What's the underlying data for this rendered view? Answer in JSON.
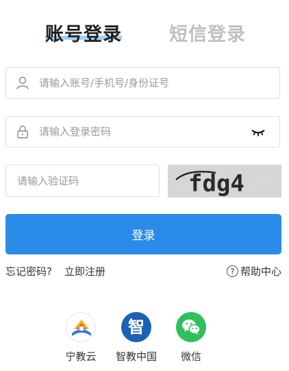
{
  "tabs": {
    "account": "账号登录",
    "sms": "短信登录"
  },
  "account_field": {
    "placeholder": "请输入账号/手机号/身份证号"
  },
  "password_field": {
    "placeholder": "请输入登录密码"
  },
  "captcha_field": {
    "placeholder": "请输入验证码"
  },
  "captcha_image": {
    "text": "fdg4"
  },
  "login_button": {
    "label": "登录"
  },
  "links": {
    "forgot": "忘记密码?",
    "register": "立即注册",
    "help_icon": "?",
    "help": "帮助中心"
  },
  "third_party": [
    {
      "name": "宁教云",
      "icon": "ningjiaoyun-logo"
    },
    {
      "name": "智教中国",
      "icon": "zhijiao-logo"
    },
    {
      "name": "微信",
      "icon": "wechat-logo"
    }
  ],
  "colors": {
    "primary": "#2b8be8",
    "tab_underline": "#9ed0f3",
    "wechat": "#2ec15a",
    "zhijiao": "#1c62b4"
  },
  "zhijiao_logo_char": "智"
}
